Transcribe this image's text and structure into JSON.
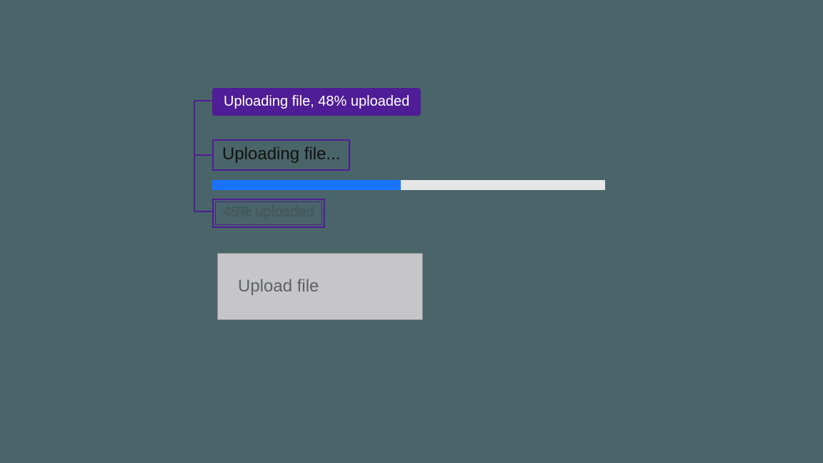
{
  "upload": {
    "live_region_text": "Uploading file, 48% uploaded",
    "status_label": "Uploading file...",
    "percent_label": "48% uploaded",
    "progress_percent": 48,
    "button_label": "Upload file"
  },
  "colors": {
    "annotation_purple": "#4f1d95",
    "progress_fill": "#1874ff",
    "progress_track": "#e6e6e6",
    "button_bg": "#c6c6c8",
    "page_bg": "#4a6569"
  }
}
